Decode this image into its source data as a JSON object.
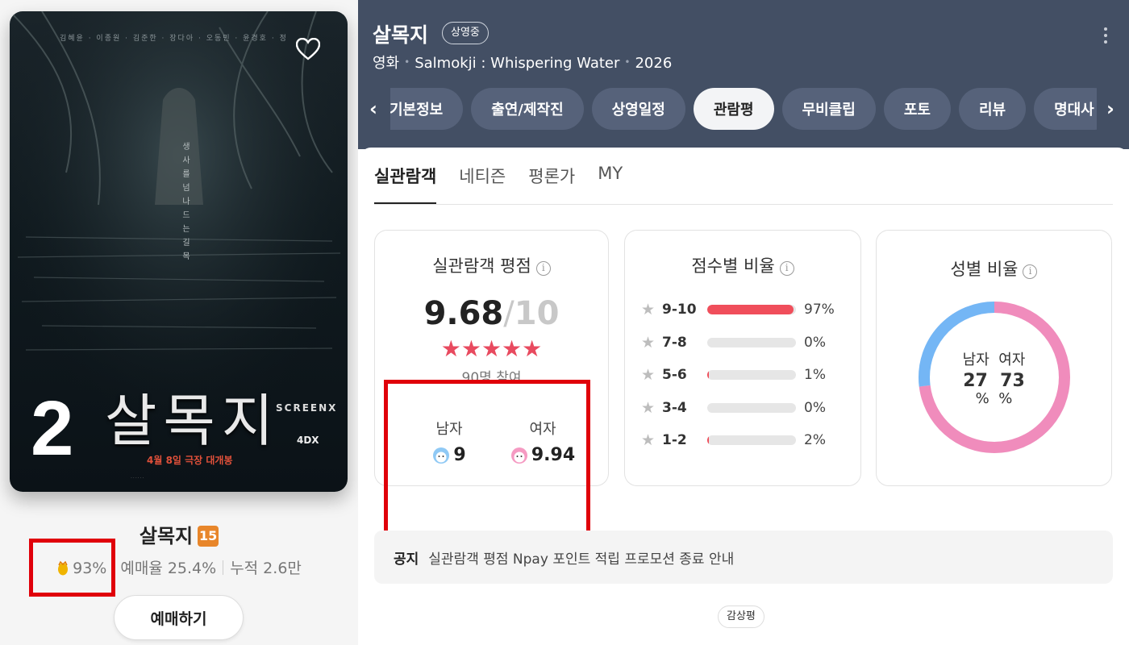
{
  "left": {
    "poster": {
      "cast_strip": "김혜윤 · 이종원 · 김준한 · 장다아 · 오동민 · 윤경호 · 정",
      "tagline": "생사를넘나드는길목",
      "rank": "2",
      "title_art": "살목지",
      "format_screenx": "SCREENX",
      "format_4dx": "4DX",
      "release": "4월 8일 극장 대개봉",
      "credits": "......"
    },
    "title": "살목지",
    "age_rating": "15",
    "egg_score": "93%",
    "booking_rate": "예매율 25.4%",
    "cumulative": "누적 2.6만",
    "book_button": "예매하기"
  },
  "header": {
    "title": "살목지",
    "status": "상영중",
    "meta": [
      "영화",
      "Salmokji : Whispering Water",
      "2026"
    ],
    "tabs": [
      "기본정보",
      "출연/제작진",
      "상영일정",
      "관람평",
      "무비클립",
      "포토",
      "리뷰",
      "명대사"
    ],
    "active_tab": "관람평",
    "prev_arrow": "‹",
    "next_arrow": "›"
  },
  "subtabs": [
    "실관람객",
    "네티즌",
    "평론가",
    "MY"
  ],
  "rating_card": {
    "title": "실관람객 평점",
    "score": "9.68",
    "slash": "/",
    "max": "10",
    "stars": "★★★★★",
    "participants": "90명 참여",
    "male_label": "남자",
    "male_score": "9",
    "female_label": "여자",
    "female_score": "9.94"
  },
  "distribution_card": {
    "title": "점수별 비율",
    "rows": [
      {
        "range": "9-10",
        "pct": "97%",
        "value": 97
      },
      {
        "range": "7-8",
        "pct": "0%",
        "value": 0
      },
      {
        "range": "5-6",
        "pct": "1%",
        "value": 1
      },
      {
        "range": "3-4",
        "pct": "0%",
        "value": 0
      },
      {
        "range": "1-2",
        "pct": "2%",
        "value": 2
      }
    ]
  },
  "gender_card": {
    "title": "성별 비율",
    "male_label": "남자",
    "female_label": "여자",
    "male_value": "27",
    "female_value": "73",
    "male_unit": "%",
    "female_unit": "%",
    "male_pct": 27,
    "female_pct": 73,
    "male_color": "#74b6f5",
    "female_color": "#f08cbc"
  },
  "notice": {
    "label": "공지",
    "text": "실관람객 평점 Npay 포인트 적립 프로모션 종료 안내"
  },
  "review_chip": "감상평",
  "colors": {
    "header_bg": "#434f64",
    "accent_red": "#e84a5f",
    "highlight_box": "#e0000a"
  }
}
